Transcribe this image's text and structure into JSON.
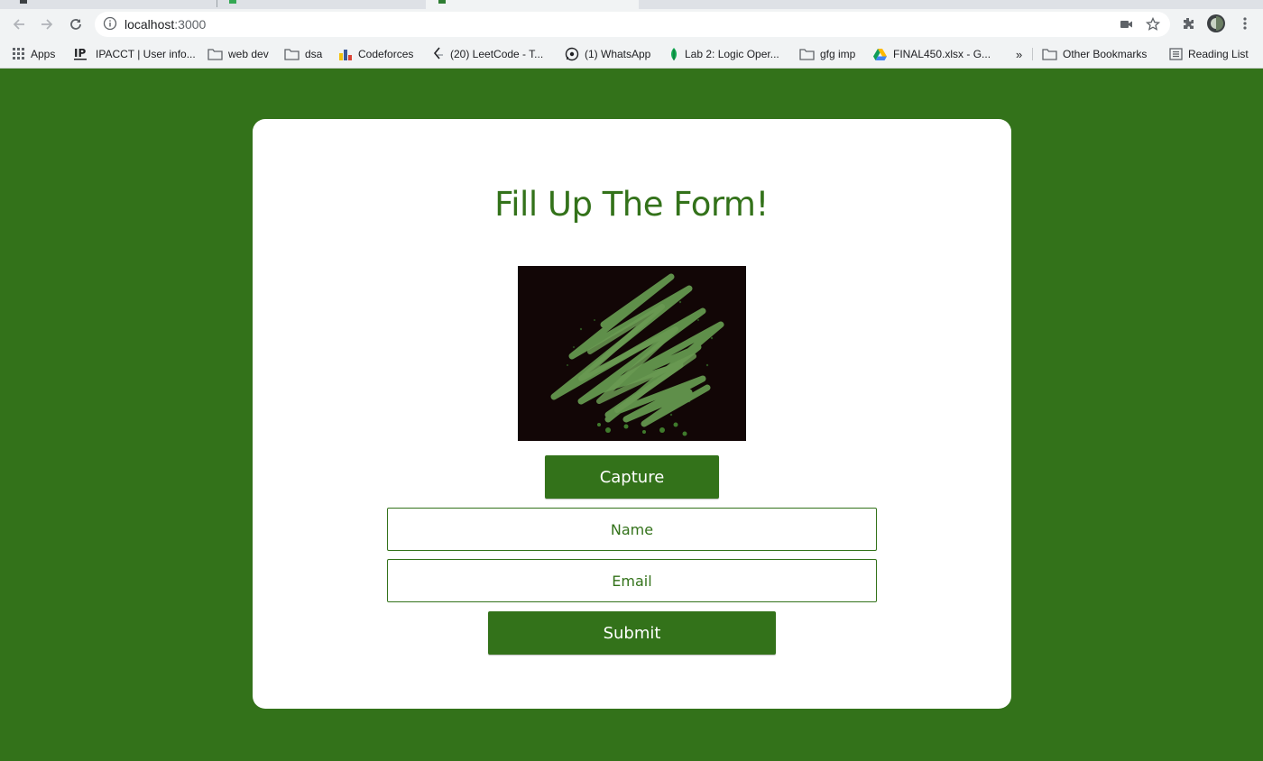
{
  "browser": {
    "url_host": "localhost",
    "url_port": ":3000",
    "bookmarks": [
      {
        "label": "Apps",
        "icon": "apps-grid-icon"
      },
      {
        "label": "IPACCT | User info...",
        "icon": "ip-logo-icon"
      },
      {
        "label": "web dev",
        "icon": "folder-icon"
      },
      {
        "label": "dsa",
        "icon": "folder-icon"
      },
      {
        "label": "Codeforces",
        "icon": "bar-chart-icon"
      },
      {
        "label": "(20) LeetCode - T...",
        "icon": "leetcode-icon"
      },
      {
        "label": "(1) WhatsApp",
        "icon": "whatsapp-icon"
      },
      {
        "label": "Lab 2: Logic Oper...",
        "icon": "leaf-icon"
      },
      {
        "label": "gfg imp",
        "icon": "folder-icon"
      },
      {
        "label": "FINAL450.xlsx - G...",
        "icon": "google-drive-icon"
      }
    ],
    "overflow_chevron": "»",
    "other_bookmarks": "Other Bookmarks",
    "reading_list": "Reading List"
  },
  "form": {
    "title": "Fill Up The Form!",
    "capture_label": "Capture",
    "name_placeholder": "Name",
    "email_placeholder": "Email",
    "submit_label": "Submit"
  },
  "colors": {
    "page_background": "#33721a",
    "accent": "#33721a",
    "card": "#ffffff",
    "webcam_background": "#120606"
  }
}
